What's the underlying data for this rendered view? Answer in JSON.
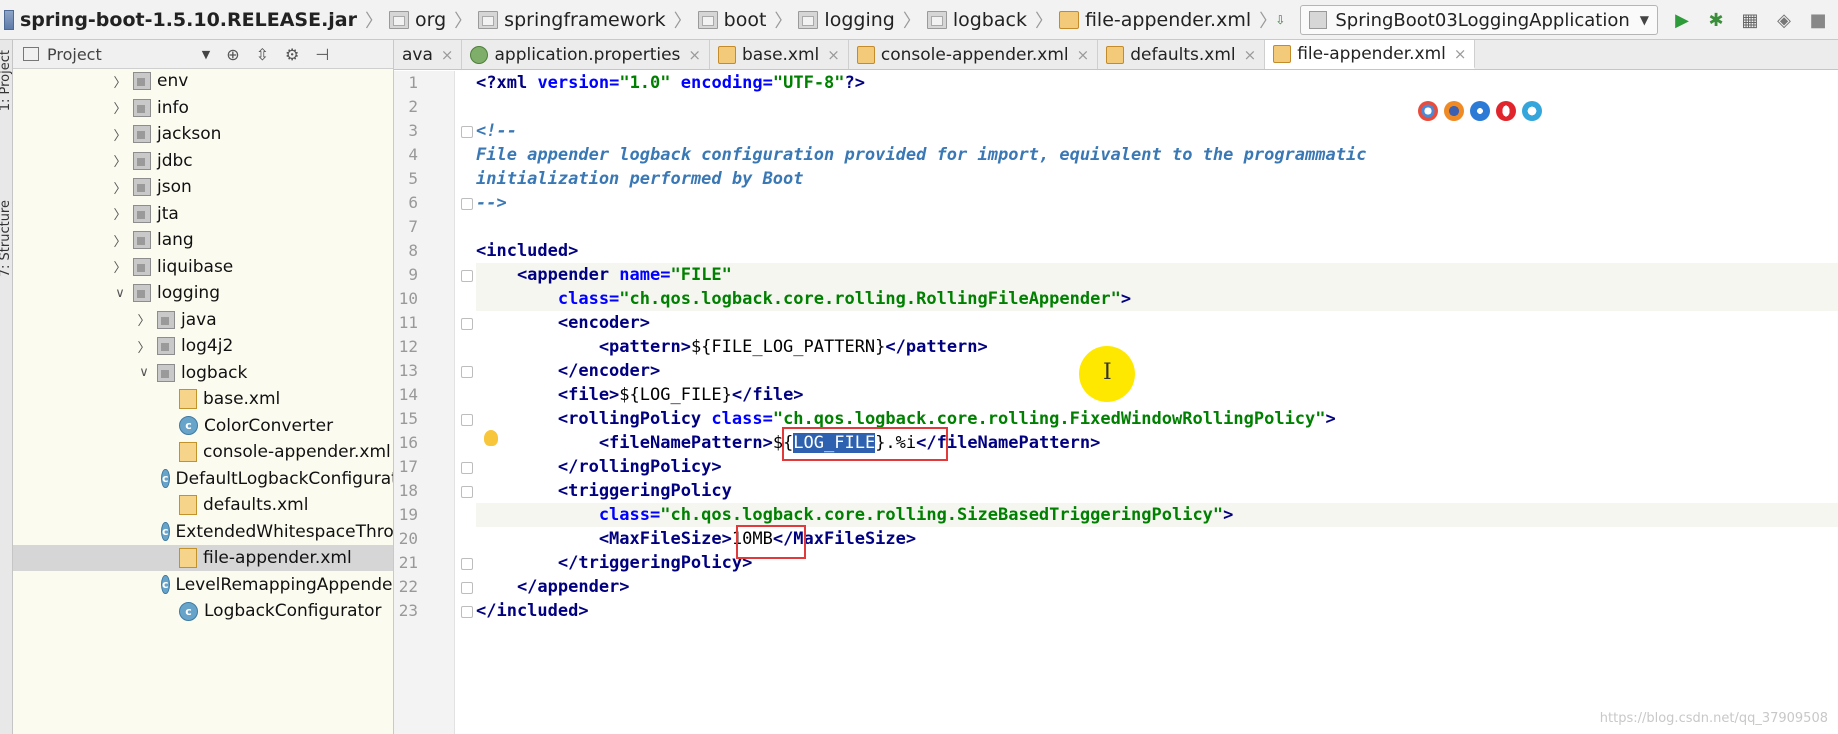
{
  "breadcrumb": {
    "jar": "spring-boot-1.5.10.RELEASE.jar",
    "items": [
      "org",
      "springframework",
      "boot",
      "logging",
      "logback"
    ],
    "file": "file-appender.xml"
  },
  "run_config": {
    "selected": "SpringBoot03LoggingApplication"
  },
  "tool_strip": {
    "project_tab": "1: Project",
    "structure_tab": "7: Structure"
  },
  "project_panel": {
    "title": "Project",
    "tree": [
      {
        "label": "env",
        "type": "package",
        "depth": 0,
        "expanded": false
      },
      {
        "label": "info",
        "type": "package",
        "depth": 0,
        "expanded": false
      },
      {
        "label": "jackson",
        "type": "package",
        "depth": 0,
        "expanded": false
      },
      {
        "label": "jdbc",
        "type": "package",
        "depth": 0,
        "expanded": false
      },
      {
        "label": "json",
        "type": "package",
        "depth": 0,
        "expanded": false
      },
      {
        "label": "jta",
        "type": "package",
        "depth": 0,
        "expanded": false
      },
      {
        "label": "lang",
        "type": "package",
        "depth": 0,
        "expanded": false
      },
      {
        "label": "liquibase",
        "type": "package",
        "depth": 0,
        "expanded": false
      },
      {
        "label": "logging",
        "type": "package",
        "depth": 0,
        "expanded": true
      },
      {
        "label": "java",
        "type": "package",
        "depth": 1,
        "expanded": false
      },
      {
        "label": "log4j2",
        "type": "package",
        "depth": 1,
        "expanded": false
      },
      {
        "label": "logback",
        "type": "package",
        "depth": 1,
        "expanded": true
      },
      {
        "label": "base.xml",
        "type": "xml",
        "depth": 2
      },
      {
        "label": "ColorConverter",
        "type": "class",
        "depth": 2
      },
      {
        "label": "console-appender.xml",
        "type": "xml",
        "depth": 2
      },
      {
        "label": "DefaultLogbackConfigurati",
        "type": "class",
        "depth": 2
      },
      {
        "label": "defaults.xml",
        "type": "xml",
        "depth": 2
      },
      {
        "label": "ExtendedWhitespaceThrow",
        "type": "class",
        "depth": 2
      },
      {
        "label": "file-appender.xml",
        "type": "xml",
        "depth": 2,
        "selected": true
      },
      {
        "label": "LevelRemappingAppender",
        "type": "class",
        "depth": 2
      },
      {
        "label": "LogbackConfigurator",
        "type": "class",
        "depth": 2
      }
    ]
  },
  "tabs": [
    {
      "label": "ava",
      "icon": "none"
    },
    {
      "label": "application.properties",
      "icon": "properties"
    },
    {
      "label": "base.xml",
      "icon": "xml"
    },
    {
      "label": "console-appender.xml",
      "icon": "xml"
    },
    {
      "label": "defaults.xml",
      "icon": "xml"
    },
    {
      "label": "file-appender.xml",
      "icon": "xml",
      "active": true
    }
  ],
  "editor": {
    "lines": [
      [
        {
          "t": "<?",
          "c": "tag"
        },
        {
          "t": "xml ",
          "c": "tag"
        },
        {
          "t": "version=",
          "c": "attr"
        },
        {
          "t": "\"1.0\"",
          "c": "val"
        },
        {
          "t": " encoding=",
          "c": "attr"
        },
        {
          "t": "\"UTF-8\"",
          "c": "val"
        },
        {
          "t": "?>",
          "c": "tag"
        }
      ],
      [],
      [
        {
          "t": "<!--",
          "c": "cmt"
        }
      ],
      [
        {
          "t": "File appender logback configuration provided for import, equivalent to the programmatic",
          "c": "cmt"
        }
      ],
      [
        {
          "t": "initialization performed by Boot",
          "c": "cmt"
        }
      ],
      [
        {
          "t": "-->",
          "c": "cmt"
        }
      ],
      [],
      [
        {
          "t": "<included>",
          "c": "tag"
        }
      ],
      [
        {
          "t": "    <appender ",
          "c": "tag"
        },
        {
          "t": "name=",
          "c": "attr"
        },
        {
          "t": "\"FILE\"",
          "c": "val"
        }
      ],
      [
        {
          "t": "        class=",
          "c": "attr"
        },
        {
          "t": "\"ch.qos.logback.core.rolling.RollingFileAppender\"",
          "c": "val"
        },
        {
          "t": ">",
          "c": "tag"
        }
      ],
      [
        {
          "t": "        <encoder>",
          "c": "tag"
        }
      ],
      [
        {
          "t": "            <pattern>",
          "c": "tag"
        },
        {
          "t": "${FILE_LOG_PATTERN}",
          "c": "txt"
        },
        {
          "t": "</pattern>",
          "c": "tag"
        }
      ],
      [
        {
          "t": "        </encoder>",
          "c": "tag"
        }
      ],
      [
        {
          "t": "        <file>",
          "c": "tag"
        },
        {
          "t": "${LOG_FILE}",
          "c": "txt"
        },
        {
          "t": "</file>",
          "c": "tag"
        }
      ],
      [
        {
          "t": "        <rollingPolicy ",
          "c": "tag"
        },
        {
          "t": "class=",
          "c": "attr"
        },
        {
          "t": "\"ch.qos.logback.core.rolling.FixedWindowRollingPolicy\"",
          "c": "val"
        },
        {
          "t": ">",
          "c": "tag"
        }
      ],
      [
        {
          "t": "            <fileNamePattern>",
          "c": "tag"
        },
        {
          "t": "${",
          "c": "txt"
        },
        {
          "t": "LOG_FILE",
          "c": "sel"
        },
        {
          "t": "}.%i",
          "c": "txt"
        },
        {
          "t": "</fileNamePattern>",
          "c": "tag"
        }
      ],
      [
        {
          "t": "        </rollingPolicy>",
          "c": "tag"
        }
      ],
      [
        {
          "t": "        <triggeringPolicy",
          "c": "tag"
        }
      ],
      [
        {
          "t": "            class=",
          "c": "attr"
        },
        {
          "t": "\"ch.qos.logback.core.rolling.SizeBasedTriggeringPolicy\"",
          "c": "val"
        },
        {
          "t": ">",
          "c": "tag"
        }
      ],
      [
        {
          "t": "            <MaxFileSize>",
          "c": "tag"
        },
        {
          "t": "10MB",
          "c": "txt"
        },
        {
          "t": "</MaxFileSize>",
          "c": "tag"
        }
      ],
      [
        {
          "t": "        </triggeringPolicy>",
          "c": "tag"
        }
      ],
      [
        {
          "t": "    </appender>",
          "c": "tag"
        }
      ],
      [
        {
          "t": "</included>",
          "c": "tag"
        }
      ]
    ]
  },
  "watermark": "https://blog.csdn.net/qq_37909508"
}
